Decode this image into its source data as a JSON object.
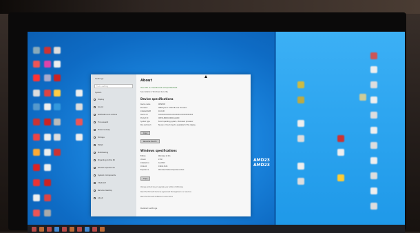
{
  "settings": {
    "side": {
      "title": "Settings",
      "search_placeholder": "Find a setting",
      "section": "System",
      "items": [
        "Display",
        "Sound",
        "Notifications & actions",
        "Focus assist",
        "Power & sleep",
        "Storage",
        "Tablet",
        "Multitasking",
        "Projecting to this PC",
        "Shared experiences",
        "System Components",
        "Clipboard",
        "Remote Desktop",
        "About"
      ]
    },
    "main": {
      "title": "About",
      "protection": "Your PC is monitored and protected.",
      "details_link": "See details in Windows Security",
      "device_specs_heading": "Device specifications",
      "device_specs": [
        {
          "k": "Device name",
          "v": "DESKTOP"
        },
        {
          "k": "Processor",
          "v": "AMD Ryzen 7 3700X 8-Core Processor"
        },
        {
          "k": "Installed RAM",
          "v": "16.0 GB"
        },
        {
          "k": "Device ID",
          "v": "XXXXXXXX-XXXX-XXXX-XXXX-XXXXXXXXXXXX"
        },
        {
          "k": "Product ID",
          "v": "00330-80000-00000-AA000"
        },
        {
          "k": "System type",
          "v": "64-bit operating system, x64-based processor"
        },
        {
          "k": "Pen and touch",
          "v": "No pen or touch input is available for this display"
        }
      ],
      "copy_btn": "Copy",
      "rename_btn": "Rename this PC",
      "win_specs_heading": "Windows specifications",
      "win_specs": [
        {
          "k": "Edition",
          "v": "Windows 10 Pro"
        },
        {
          "k": "Version",
          "v": "21H2"
        },
        {
          "k": "Installed on",
          "v": "1/1/2022"
        },
        {
          "k": "OS build",
          "v": "19044.1526"
        },
        {
          "k": "Experience",
          "v": "Windows Feature Experience Pack"
        }
      ],
      "copy_btn2": "Copy",
      "links": [
        "Change product key or upgrade your edition of Windows",
        "Read the Microsoft Services Agreement that applies to our services",
        "Read the Microsoft Software License Terms"
      ],
      "related": "Related settings"
    }
  },
  "seam_labels": [
    "AMD23",
    "AMD23"
  ]
}
